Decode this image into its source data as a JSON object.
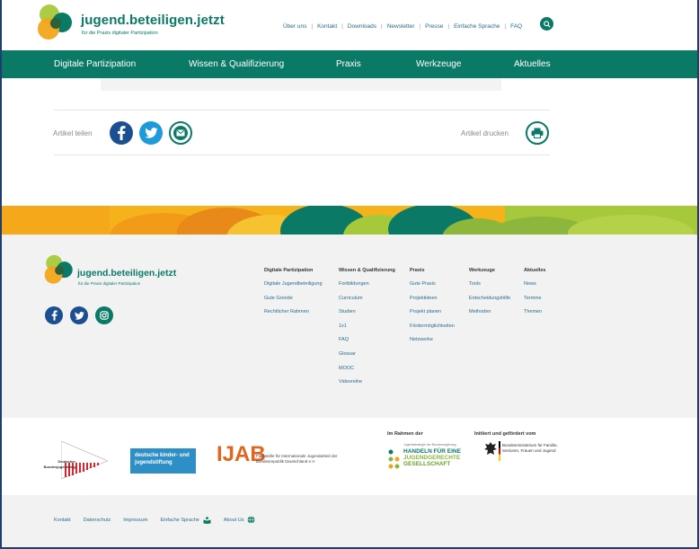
{
  "header": {
    "logo_title": "jugend.beteiligen.jetzt",
    "logo_subtitle": "für die Praxis digitaler Partizipation",
    "top_links": [
      "Über uns",
      "Kontakt",
      "Downloads",
      "Newsletter",
      "Presse",
      "Einfache Sprache",
      "FAQ"
    ],
    "search_icon": "search-icon"
  },
  "nav": {
    "items": [
      "Digitale Partizipation",
      "Wissen & Qualifizierung",
      "Praxis",
      "Werkzeuge",
      "Aktuelles"
    ]
  },
  "article": {
    "share_label": "Artikel teilen",
    "print_label": "Artikel drucken",
    "share_icons": [
      "facebook-icon",
      "twitter-icon",
      "mail-icon"
    ],
    "print_icon": "printer-icon"
  },
  "footer": {
    "logo_title": "jugend.beteiligen.jetzt",
    "logo_subtitle": "für die Praxis digitaler Partizipation",
    "social_icons": [
      "facebook-icon",
      "twitter-icon",
      "instagram-icon"
    ],
    "columns": [
      {
        "heading": "Digitale Partizipation",
        "links": [
          "Digitale Jugendbeteiligung",
          "Gute Gründe",
          "Rechtlicher Rahmen"
        ]
      },
      {
        "heading": "Wissen & Qualifizierung",
        "links": [
          "Fortbildungen",
          "Curriculum",
          "Studien",
          "1x1",
          "FAQ",
          "Glossar",
          "MOOC",
          "Videoreihe"
        ]
      },
      {
        "heading": "Praxis",
        "links": [
          "Gute Praxis",
          "Projektideen",
          "Projekt planen",
          "Fördermöglichkeiten",
          "Netzwerke"
        ]
      },
      {
        "heading": "Werkzeuge",
        "links": [
          "Tools",
          "Entscheidungshilfe",
          "Methoden"
        ]
      },
      {
        "heading": "Aktuelles",
        "links": [
          "News",
          "Termine",
          "Themen"
        ]
      }
    ]
  },
  "partners": {
    "dbjr": "Deutscher Bundesjugendring",
    "dkjs": "deutsche kinder- und jugendstiftung",
    "ijab_logo": "IJAB",
    "ijab_text": "Fachstelle für Internationale Jugendarbeit der Bundesrepublik Deutschland e.V.",
    "im_rahmen_heading": "Im Rahmen der",
    "handeln_small": "Jugendstrategie der Bundesregierung",
    "handeln_line1": "HANDELN FÜR EINE",
    "handeln_line2": "JUGENDGERECHTE",
    "handeln_line3": "GESELLSCHAFT",
    "initiiert_heading": "Initiiert und gefördert vom",
    "bmfsfj": "Bundesministerium für Familie, Senioren, Frauen und Jugend"
  },
  "bottom": {
    "links": [
      "Kontakt",
      "Datenschutz",
      "Impressum",
      "Einfache Sprache",
      "About Us"
    ]
  },
  "colors": {
    "brand_green": "#0a7a67",
    "link_blue": "#2a6c8c",
    "facebook": "#1c4f91",
    "twitter": "#1d9bd8"
  }
}
